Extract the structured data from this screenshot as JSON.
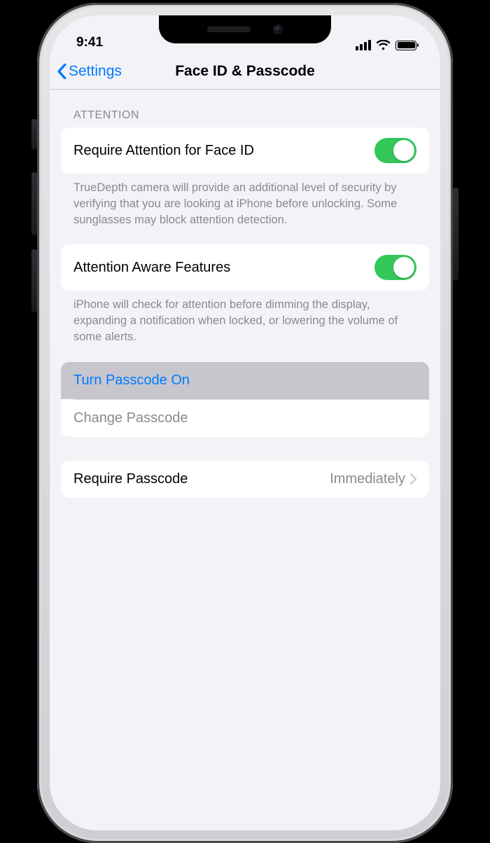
{
  "status": {
    "time": "9:41"
  },
  "nav": {
    "back_label": "Settings",
    "title": "Face ID & Passcode"
  },
  "attention_section": {
    "header": "ATTENTION",
    "require_attention": {
      "label": "Require Attention for Face ID",
      "enabled": true,
      "footer": "TrueDepth camera will provide an additional level of security by verifying that you are looking at iPhone before unlocking. Some sunglasses may block attention detection."
    },
    "attention_aware": {
      "label": "Attention Aware Features",
      "enabled": true,
      "footer": "iPhone will check for attention before dimming the display, expanding a notification when locked, or lowering the volume of some alerts."
    }
  },
  "passcode_section": {
    "turn_on_label": "Turn Passcode On",
    "change_label": "Change Passcode"
  },
  "require_section": {
    "label": "Require Passcode",
    "value": "Immediately"
  },
  "colors": {
    "accent": "#007aff",
    "toggle_on": "#34c759"
  }
}
